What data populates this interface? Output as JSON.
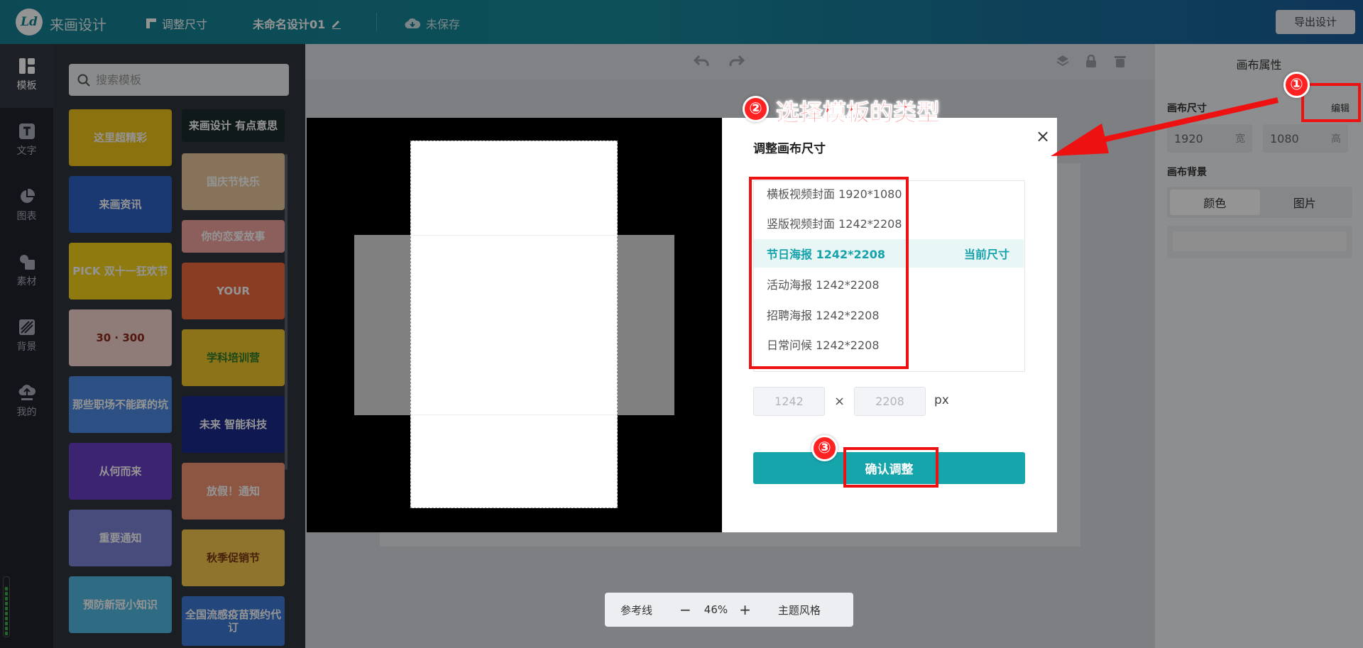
{
  "header": {
    "brand": "来画设计",
    "resize_label": "调整尺寸",
    "doc_title": "未命名设计01",
    "save_status": "未保存",
    "export_label": "导出设计"
  },
  "nav": [
    {
      "label": "模板",
      "icon": "template-icon"
    },
    {
      "label": "文字",
      "icon": "text-icon"
    },
    {
      "label": "图表",
      "icon": "chart-icon"
    },
    {
      "label": "素材",
      "icon": "material-icon"
    },
    {
      "label": "背景",
      "icon": "background-icon"
    },
    {
      "label": "我的",
      "icon": "cloud-upload-icon"
    }
  ],
  "search": {
    "placeholder": "搜索模板"
  },
  "templates": [
    {
      "text": "这里超精彩",
      "color": "#f2c519"
    },
    {
      "text": "来画设计 有点意思",
      "color": "#1a2b2b"
    },
    {
      "text": "来画资讯",
      "color": "#2d63c7"
    },
    {
      "text": "国庆节快乐",
      "color": "#e8c69a"
    },
    {
      "text": "PICK 双十一狂欢节",
      "color": "#f4d21b"
    },
    {
      "text": "你的恋爱故事",
      "color": "#f1a4a0"
    },
    {
      "text": "YOUR",
      "color": "#ee6a3d"
    },
    {
      "text": "30 · 300",
      "color": "#f6d5cf"
    },
    {
      "text": "学科培训营",
      "color": "#f2c52b"
    },
    {
      "text": "那些职场不能踩的坑",
      "color": "#4c8be2"
    },
    {
      "text": "未来 智能科技",
      "color": "#1b2a8c"
    },
    {
      "text": "从何而来",
      "color": "#6a3ec7"
    },
    {
      "text": "放假！通知",
      "color": "#f29572"
    },
    {
      "text": "重要通知",
      "color": "#7b83d8"
    },
    {
      "text": "秋季促销节",
      "color": "#f7c84e"
    },
    {
      "text": "预防新冠小知识",
      "color": "#52b8e0"
    },
    {
      "text": "全国流感疫苗预约代订",
      "color": "#3d7bd6"
    }
  ],
  "workspace": {
    "zoom_label_ref": "参考线",
    "zoom_minus": "−",
    "zoom_value": "46%",
    "zoom_plus": "+",
    "theme_label": "主题风格"
  },
  "props": {
    "title": "画布属性",
    "size_label": "画布尺寸",
    "edit_label": "编辑",
    "width": "1920",
    "width_unit": "宽",
    "height": "1080",
    "height_unit": "高",
    "bg_label": "画布背景",
    "tab_color": "颜色",
    "tab_image": "图片"
  },
  "modal": {
    "title": "调整画布尺寸",
    "close": "×",
    "sizes": [
      {
        "label": "横板视频封面 1920*1080"
      },
      {
        "label": "竖版视频封面 1242*2208"
      },
      {
        "label": "节日海报 1242*2208",
        "current": "当前尺寸"
      },
      {
        "label": "活动海报 1242*2208"
      },
      {
        "label": "招聘海报 1242*2208"
      },
      {
        "label": "日常问候 1242*2208"
      }
    ],
    "width_placeholder": "1242",
    "height_placeholder": "2208",
    "times": "×",
    "unit": "px",
    "confirm": "确认调整"
  },
  "annotations": {
    "step1": "①",
    "step2": "②",
    "step2_text": "选择模板的类型",
    "step3": "③"
  },
  "colors": {
    "accent": "#17a5ac",
    "annotation_red": "#ee1111"
  }
}
